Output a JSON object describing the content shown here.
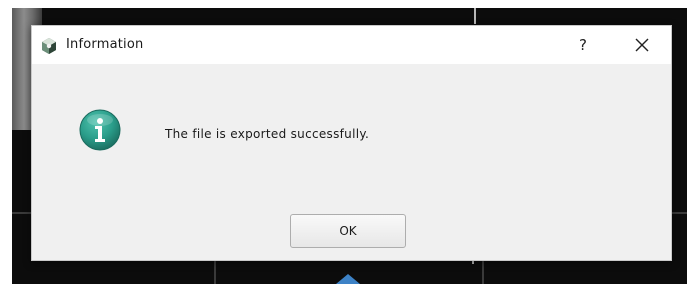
{
  "dialog": {
    "title": "Information",
    "help_label": "?",
    "message": "The file is exported successfully.",
    "ok_label": "OK"
  },
  "icons": {
    "app": "app-logo-icon",
    "info": "info-icon",
    "close": "close-icon"
  },
  "colors": {
    "info_icon_teal": "#2a9d8a",
    "pointer_blue": "#3d82c6",
    "dialog_bg": "#f0f0f0"
  }
}
